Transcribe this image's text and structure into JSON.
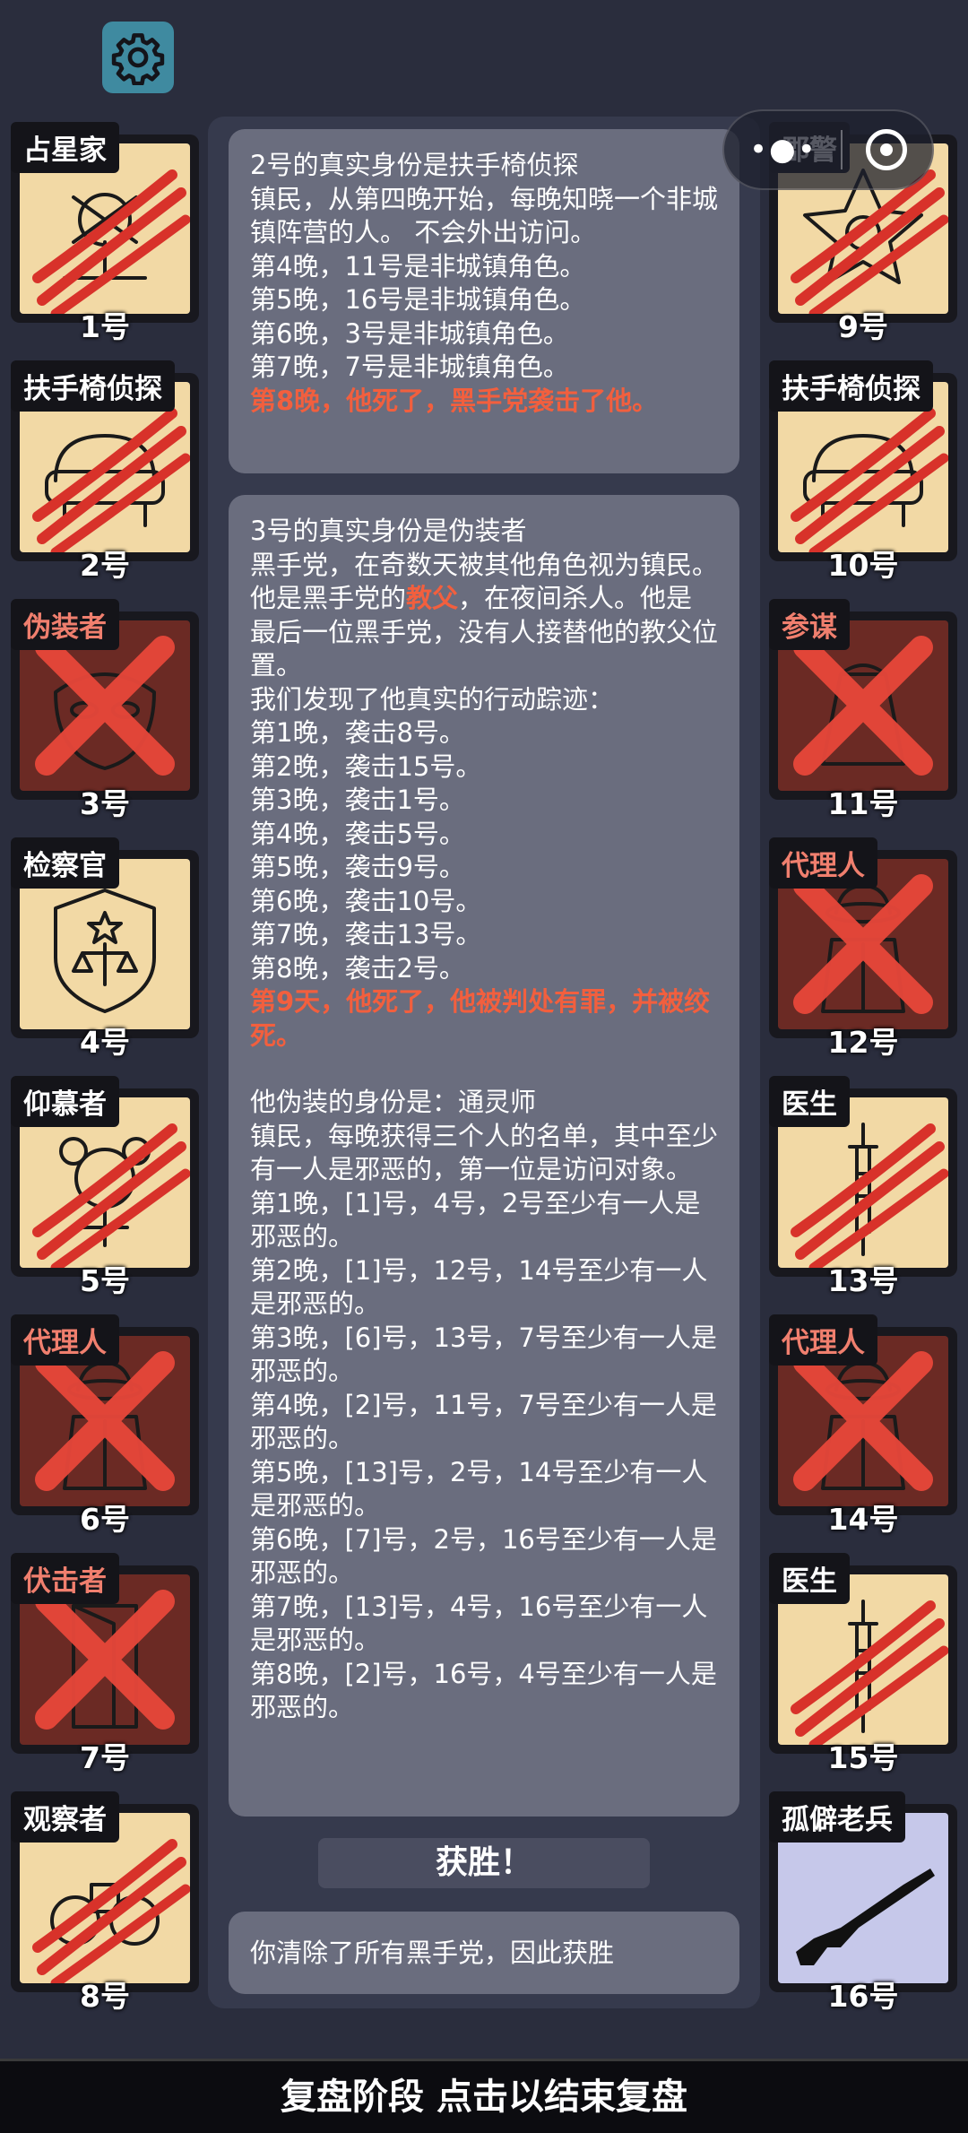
{
  "header": {
    "settings_icon": "gear-icon",
    "capsule_menu_icon": "more-dots-icon",
    "capsule_close_icon": "target-icon"
  },
  "left_cards": [
    {
      "role": "占星家",
      "number": "1号",
      "icon": "astrologer-icon",
      "state": "claw-marks"
    },
    {
      "role": "扶手椅侦探",
      "number": "2号",
      "icon": "armchair-icon",
      "state": "claw-marks"
    },
    {
      "role": "伪装者",
      "number": "3号",
      "icon": "mask-icon",
      "state": "crossed"
    },
    {
      "role": "检察官",
      "number": "4号",
      "icon": "justice-badge-icon",
      "state": "alive"
    },
    {
      "role": "仰慕者",
      "number": "5号",
      "icon": "admirer-icon",
      "state": "claw-marks"
    },
    {
      "role": "代理人",
      "number": "6号",
      "icon": "agent-icon",
      "state": "crossed"
    },
    {
      "role": "伏击者",
      "number": "7号",
      "icon": "door-icon",
      "state": "crossed"
    },
    {
      "role": "观察者",
      "number": "8号",
      "icon": "binoculars-icon",
      "state": "claw-marks"
    }
  ],
  "right_cards": [
    {
      "role": "郡警",
      "number": "9号",
      "icon": "sheriff-star-icon",
      "state": "claw-marks"
    },
    {
      "role": "扶手椅侦探",
      "number": "10号",
      "icon": "armchair-icon",
      "state": "claw-marks"
    },
    {
      "role": "参谋",
      "number": "11号",
      "icon": "strategist-icon",
      "state": "crossed"
    },
    {
      "role": "代理人",
      "number": "12号",
      "icon": "agent-icon",
      "state": "crossed"
    },
    {
      "role": "医生",
      "number": "13号",
      "icon": "syringe-icon",
      "state": "claw-marks"
    },
    {
      "role": "代理人",
      "number": "14号",
      "icon": "agent-icon",
      "state": "crossed"
    },
    {
      "role": "医生",
      "number": "15号",
      "icon": "syringe-icon",
      "state": "claw-marks"
    },
    {
      "role": "孤僻老兵",
      "number": "16号",
      "icon": "rifle-icon",
      "state": "alive"
    }
  ],
  "box1": {
    "lines": [
      "2号的真实身份是扶手椅侦探",
      "镇民，从第四晚开始，每晚知晓一个非城镇阵营的人。 不会外出访问。",
      "第4晚，11号是非城镇角色。",
      "第5晚，16号是非城镇角色。",
      "第6晚，3号是非城镇角色。",
      "第7晚，7号是非城镇角色。"
    ],
    "death": "第8晚，他死了，黑手党袭击了他。"
  },
  "box2": {
    "title": "3号的真实身份是伪装者",
    "desc": "黑手党，在奇数天被其他角色视为镇民。",
    "godfather_pre": "他是黑手党的",
    "godfather_word": "教父",
    "godfather_post": "，在夜间杀人。他是最后一位黑手党，没有人接替他的教父位置。",
    "trace_intro": "我们发现了他真实的行动踪迹：",
    "traces": [
      "第1晚，袭击8号。",
      "第2晚，袭击15号。",
      "第3晚，袭击1号。",
      "第4晚，袭击5号。",
      "第5晚，袭击9号。",
      "第6晚，袭击10号。",
      "第7晚，袭击13号。",
      "第8晚，袭击2号。"
    ],
    "death": "第9天，他死了，他被判处有罪，并被绞死。",
    "disguise_title": "他伪装的身份是：通灵师",
    "disguise_desc": "镇民，每晚获得三个人的名单，其中至少有一人是邪恶的，第一位是访问对象。",
    "disguise_nights": [
      "第1晚，[1]号，4号，2号至少有一人是邪恶的。",
      "第2晚，[1]号，12号，14号至少有一人是邪恶的。",
      "第3晚，[6]号，13号，7号至少有一人是邪恶的。",
      "第4晚，[2]号，11号，7号至少有一人是邪恶的。",
      "第5晚，[13]号，2号，14号至少有一人是邪恶的。",
      "第6晚，[7]号，2号，16号至少有一人是邪恶的。",
      "第7晚，[13]号，4号，16号至少有一人是邪恶的。",
      "第8晚，[2]号，16号，4号至少有一人是邪恶的。"
    ]
  },
  "result": {
    "title": "获胜！",
    "message": "你清除了所有黑手党，因此获胜"
  },
  "footer": {
    "label": "复盘阶段 点击以结束复盘"
  }
}
